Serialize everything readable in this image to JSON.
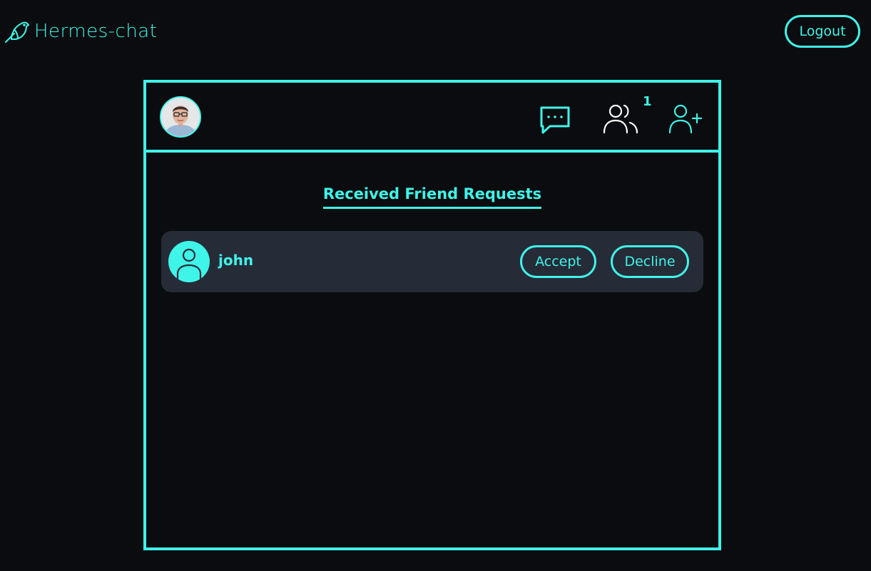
{
  "app": {
    "name": "Hermes-chat",
    "logout_label": "Logout"
  },
  "header": {
    "icons": [
      "chat-bubble-icon",
      "friends-icon",
      "add-friend-icon"
    ],
    "friend_request_count": "1"
  },
  "requests": {
    "title": "Received Friend Requests",
    "items": [
      {
        "username": "john",
        "accept_label": "Accept",
        "decline_label": "Decline"
      }
    ]
  },
  "colors": {
    "accent": "#3ff5e8",
    "background": "#0b0c0f",
    "card": "#262b38"
  }
}
